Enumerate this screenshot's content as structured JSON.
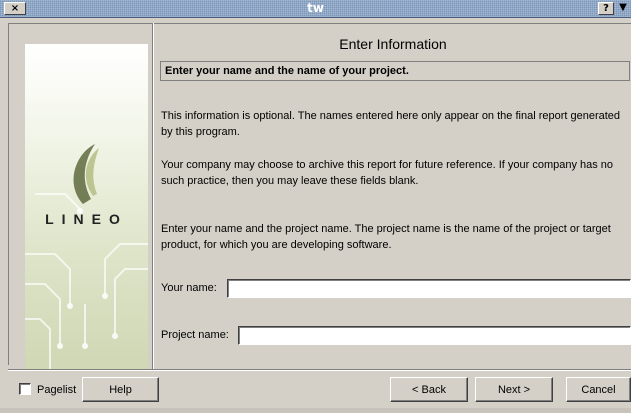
{
  "window": {
    "title": "tw",
    "close_glyph": "×",
    "help_glyph": "?",
    "menu_glyph": "▼"
  },
  "sidebar": {
    "logo_text": "LINEO",
    "logo_icon": "lineo-swoosh-logo"
  },
  "page": {
    "title": "Enter Information",
    "subtitle": "Enter your name and the name of your project.",
    "paragraphs": [
      "This information is optional. The names entered here only appear on the final report generated by this program.",
      "Your company may choose to archive this report for future reference. If your company has no such practice, then you may leave these fields blank.",
      "Enter your name and the project name. The project name is the name of the project or target product, for which you are developing software."
    ]
  },
  "form": {
    "name_label": "Your name:",
    "name_value": "",
    "project_label": "Project name:",
    "project_value": ""
  },
  "footer": {
    "pagelist_label": "Pagelist",
    "pagelist_checked": false,
    "help_label": "Help",
    "back_label": "< Back",
    "next_label": "Next >",
    "cancel_label": "Cancel"
  },
  "colors": {
    "titlebar": "#8fa9c8",
    "face": "#d4d0c8",
    "sidebar_tint": "#dde4c8"
  }
}
